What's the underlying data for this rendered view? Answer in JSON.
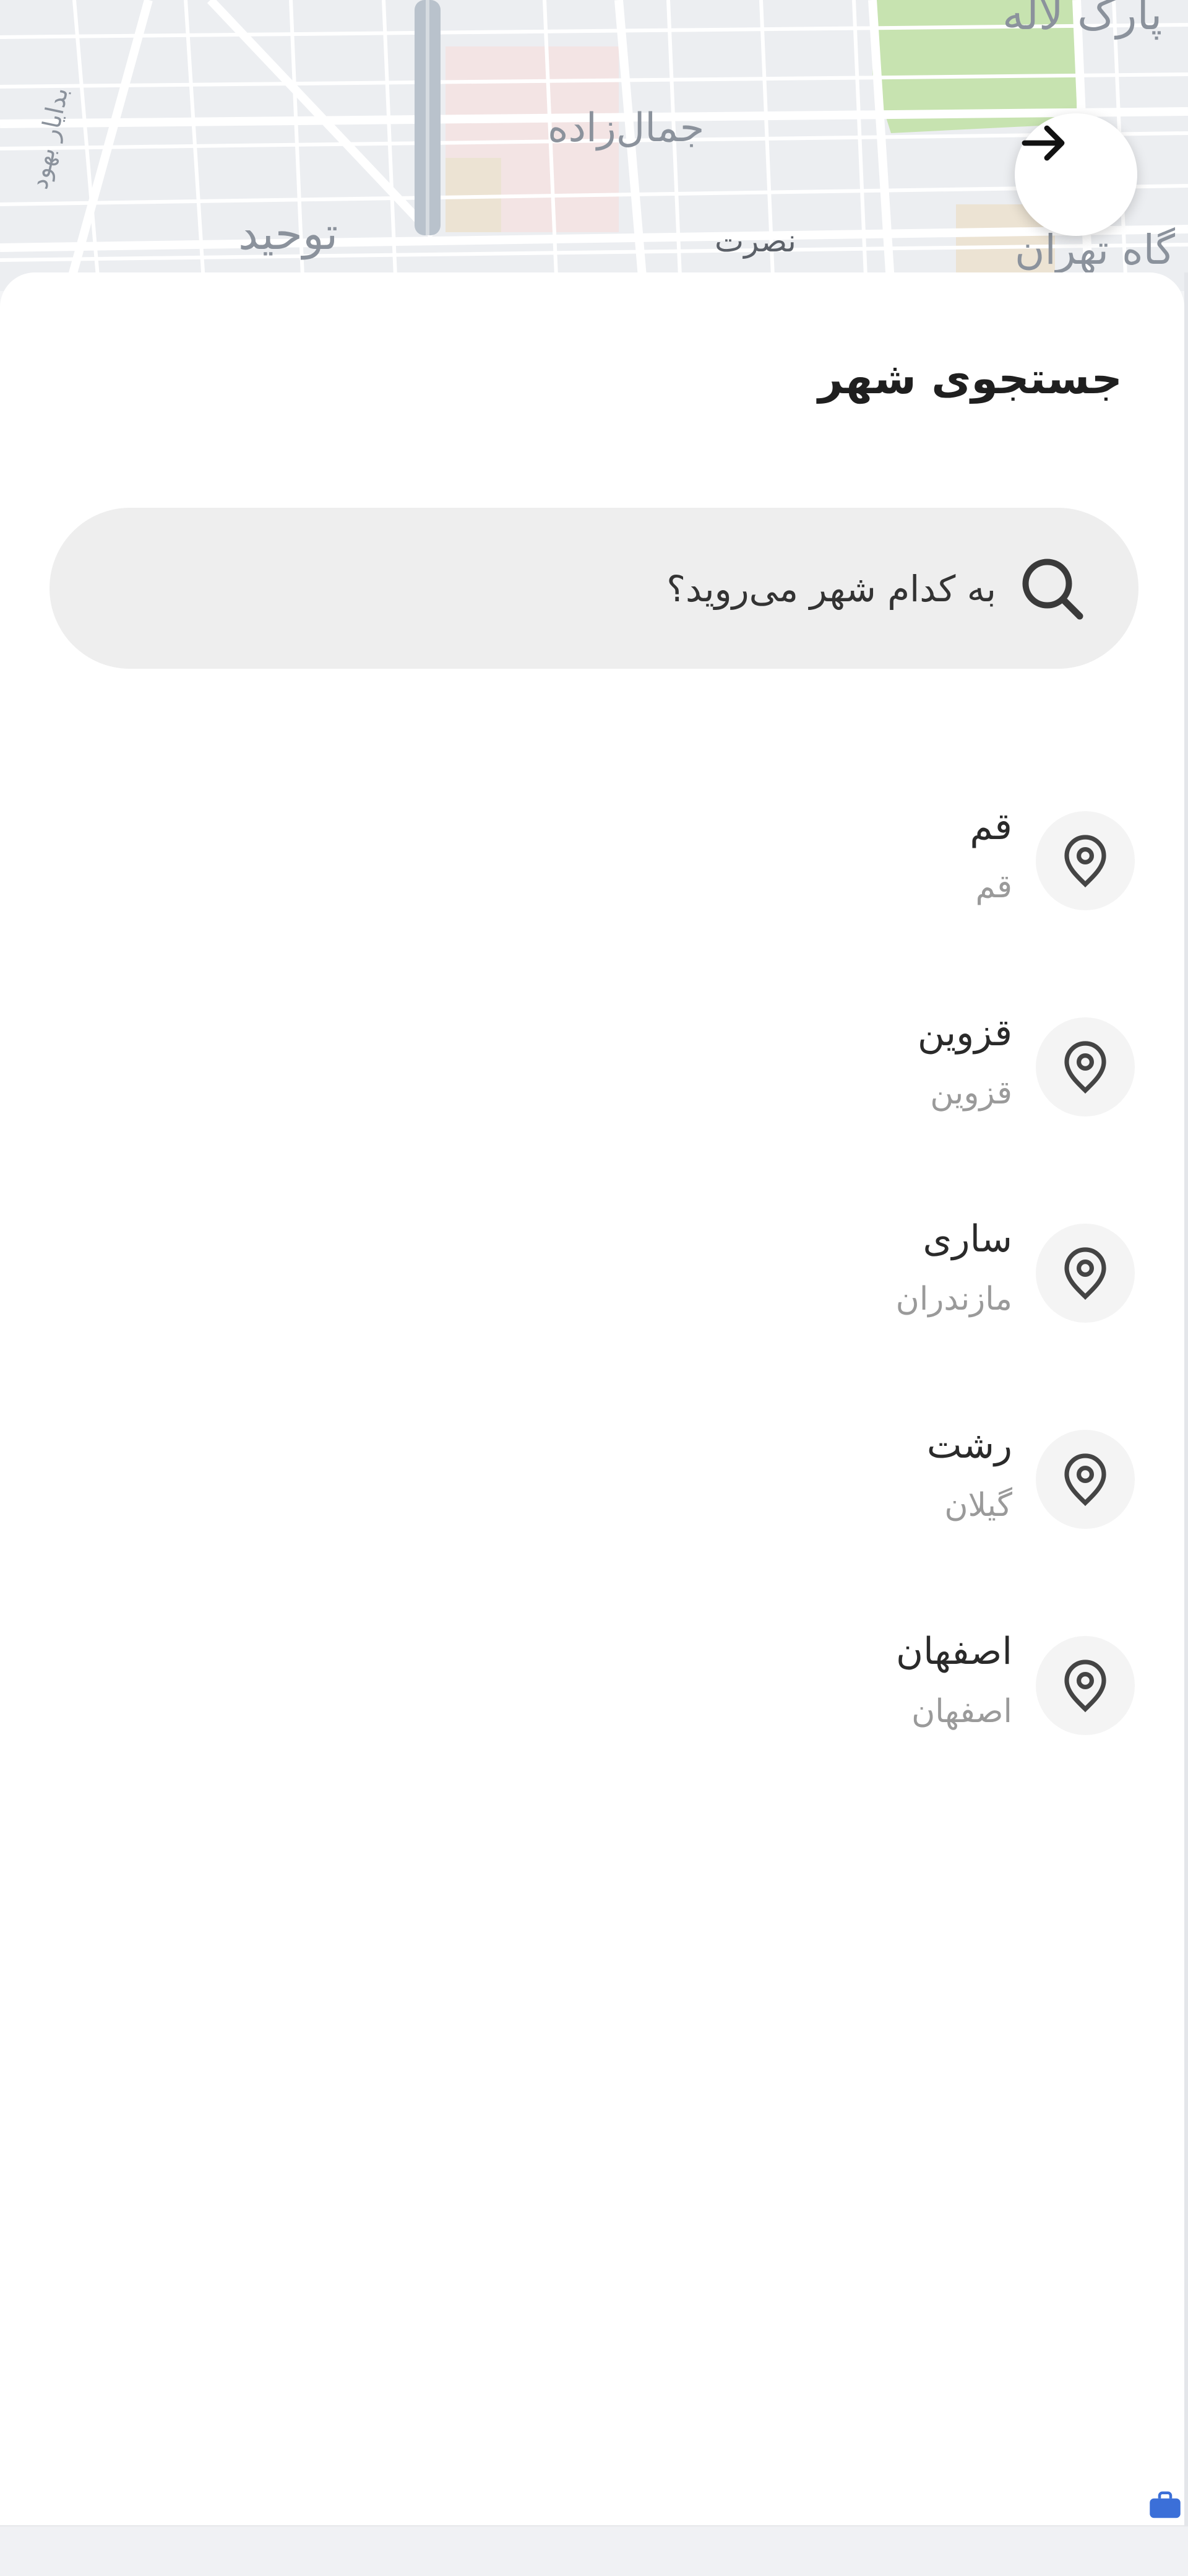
{
  "map": {
    "labels": [
      "پارک لاله",
      "جمال‌زاده",
      "توحید",
      "نصرت",
      "بدایار بهود",
      "گاه تهران"
    ]
  },
  "back_button": {
    "icon": "arrow-right-icon"
  },
  "sheet": {
    "title": "جستجوی شهر",
    "search": {
      "placeholder": "به کدام شهر می‌روید؟",
      "value": "",
      "icon": "search-icon"
    }
  },
  "cities": [
    {
      "name": "قم",
      "province": "قم",
      "icon": "location-pin-icon"
    },
    {
      "name": "قزوین",
      "province": "قزوین",
      "icon": "location-pin-icon"
    },
    {
      "name": "ساری",
      "province": "مازندران",
      "icon": "location-pin-icon"
    },
    {
      "name": "رشت",
      "province": "گیلان",
      "icon": "location-pin-icon"
    },
    {
      "name": "اصفهان",
      "province": "اصفهان",
      "icon": "location-pin-icon"
    }
  ],
  "colors": {
    "map_background": "#eceef1",
    "park": "#c7e3b0",
    "search_background": "#eeeeee",
    "text_primary": "#1f1f1f",
    "text_secondary": "#9a9a9a"
  }
}
